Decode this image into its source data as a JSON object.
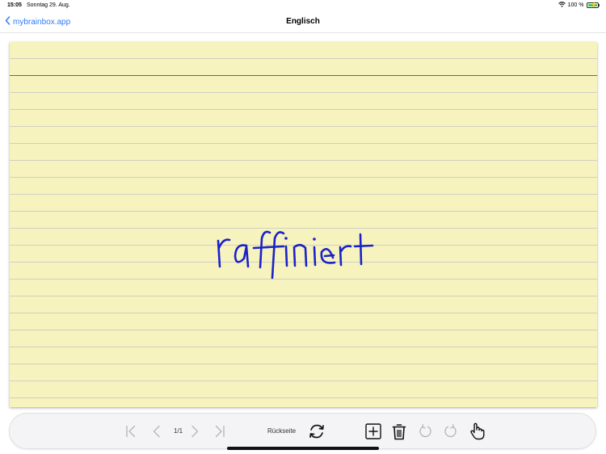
{
  "status_bar": {
    "time": "15:05",
    "date": "Sonntag 29. Aug.",
    "battery": "100 %",
    "battery_level": 1.0,
    "icons": [
      "wifi-icon",
      "battery-icon",
      "charging-bolt-icon"
    ]
  },
  "nav": {
    "back_label": "mybrainbox.app",
    "title": "Englisch"
  },
  "card": {
    "handwritten_text": "raffiniert",
    "ink_color": "#1a22c8",
    "paper_color": "#f7f3bf",
    "margin_line_color": "#b24a3a"
  },
  "toolbar": {
    "page_indicator": "1/1",
    "flip_label": "Rückseite",
    "icons": [
      "first-page-icon",
      "previous-page-icon",
      "next-page-icon",
      "last-page-icon",
      "flip-card-icon",
      "add-card-icon",
      "trash-icon",
      "undo-icon",
      "redo-icon",
      "hand-pointer-icon"
    ]
  },
  "colors": {
    "accent": "#2f7cf6",
    "disabled_icon": "#b4b4b8"
  }
}
